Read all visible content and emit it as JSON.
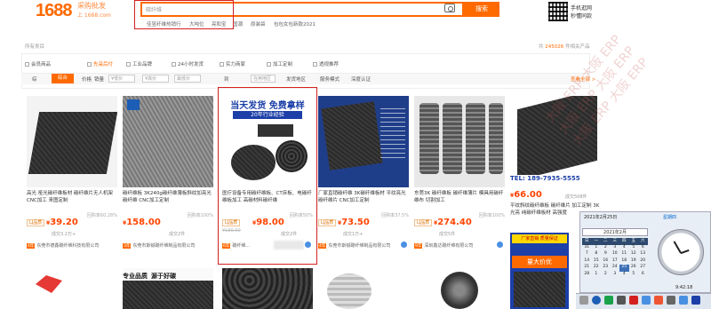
{
  "header": {
    "logo_num": "1688",
    "logo_cn": "采购批发",
    "logo_url": "上 1688.com",
    "search_value": "碳纤维",
    "search_button": "搜索",
    "hot_keywords": [
      "佳昱纤维热销行",
      "大吨位",
      "亮和宝",
      "国潮",
      "原装袋",
      "包包女包新款2021"
    ],
    "mobile_title": "手机逛网",
    "mobile_sub": "秒懂同款"
  },
  "filters": {
    "breadcrumb": "所有类目",
    "found_prefix": "共",
    "found_count": "245026",
    "found_suffix": "件相关产品",
    "options": [
      "会员商品",
      "先采后付",
      "工业品牌",
      "24小时发货",
      "实力商家",
      "加工定制",
      "透视推荐"
    ],
    "sort": {
      "selected": "综合",
      "items": [
        "价格",
        "销量",
        "■低价",
        "最低价",
        "到",
        "在用地区",
        "发货地区",
        "服务模式",
        "深度认证"
      ],
      "price_from": "¥低价",
      "price_to": "¥高价",
      "right_link": "查看全部 >"
    }
  },
  "products": [
    {
      "title": "高光 哑光碳纤维板材 碳纤维片无人机架 CNC加工 来图定制",
      "rate": "回购率60.28%",
      "tag": "LJ品质",
      "price": "39.20",
      "sales": "成交3.2万+",
      "shop": "东莞市德鑫碳纤维科技有限公司"
    },
    {
      "title": "碳纤维板 3K240g碳纤维薄板斜纹加亮光碳纤维 CNC加工定制",
      "rate": "回购率100%",
      "tag": "",
      "price": "158.00",
      "sales": "成交2件",
      "shop": "东莞市斯铖碳纤维制品有限公司"
    },
    {
      "title": "医疗设备专用碳纤维板、CT床板、电碳纤维板加工 高碳材料碳纤维",
      "rate": "回购率50%",
      "tag": "LJ品质",
      "price": "98.00",
      "strike": "¥180.00",
      "sales": "成交2件",
      "shop": "碳纤维...",
      "banner_top": "当天发货 免费拿样",
      "banner_mid": "20年行业经验"
    },
    {
      "title": "厂家直销碳纤维 3K碳纤维板材 平纹亮光碳纤维片 CNC加工定制",
      "rate": "回购率37.5%",
      "tag": "LJ品质",
      "price": "73.50",
      "sales": "成交1万+",
      "shop": "东莞市斯铖碳纤维制品有限公司"
    },
    {
      "title": "东莞3K 碳纤维板 碳纤维薄片 模具用碳纤维布 切割加工",
      "rate": "回购率100%",
      "tag": "LJ品质",
      "price": "274.40",
      "sales": "成交5件",
      "shop": "深圳鑫达碳纤维有限公司"
    },
    {
      "title": "平纹斜纹碳纤维板 碳纤维片 加工定制 3K 光亮 纯碳纤维板材 高强度",
      "rate": "",
      "tag": "",
      "price": "66.00",
      "sales": "成交508件",
      "shop": "东莞市硕达碳纤维有限公司"
    }
  ],
  "calendar": {
    "date_label": "2021年2月25日",
    "weekday": "星期四",
    "month": "2021年2月",
    "weekdays": [
      "日",
      "一",
      "二",
      "三",
      "四",
      "五",
      "六"
    ],
    "rows": [
      [
        "31",
        "1",
        "2",
        "3",
        "4",
        "5",
        "6"
      ],
      [
        "7",
        "8",
        "9",
        "10",
        "11",
        "12",
        "13"
      ],
      [
        "14",
        "15",
        "16",
        "17",
        "18",
        "19",
        "20"
      ],
      [
        "21",
        "22",
        "23",
        "24",
        "25",
        "26",
        "27"
      ],
      [
        "28",
        "1",
        "2",
        "3",
        "4",
        "5",
        "6"
      ]
    ],
    "time": "9:42:18"
  },
  "bottom": {
    "label1": "专业品质",
    "label2": "源于好碳"
  },
  "colors": {
    "brand": "#ff6a00",
    "price": "#ff4400",
    "highlight": "#d42020"
  }
}
